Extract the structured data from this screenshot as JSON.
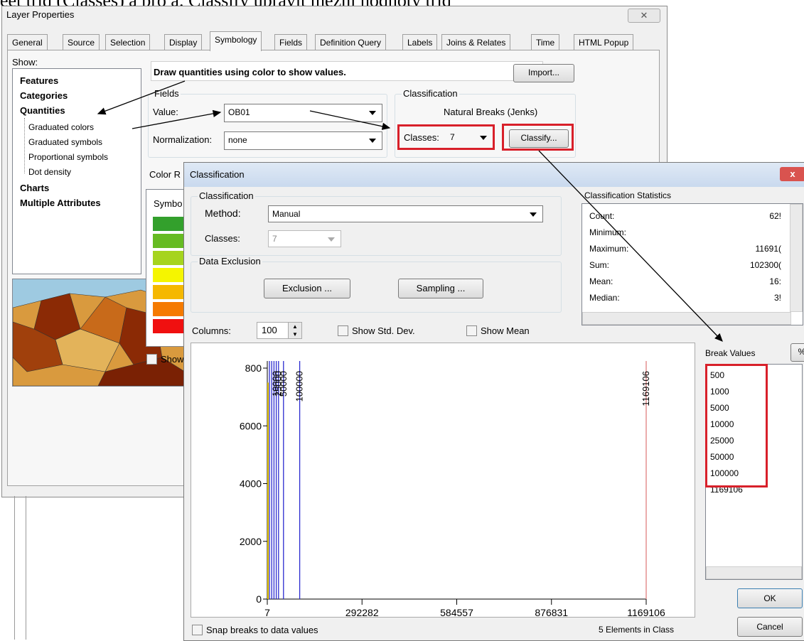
{
  "doc_text": "eet třid (Classes) a pro a. Classify upravit mezní hodnoty tříd",
  "layer_window": {
    "title": "Layer Properties",
    "tabs": [
      "General",
      "Source",
      "Selection",
      "Display",
      "Symbology",
      "Fields",
      "Definition Query",
      "Labels",
      "Joins & Relates",
      "Time",
      "HTML Popup"
    ],
    "show_label": "Show:",
    "tree": [
      "Features",
      "Categories",
      "Quantities",
      "Graduated colors",
      "Graduated symbols",
      "Proportional symbols",
      "Dot density",
      "Charts",
      "Multiple Attributes"
    ],
    "description": "Draw quantities using color to show values.",
    "import_label": "Import...",
    "fields_group": "Fields",
    "value_label": "Value:",
    "value": "OB01",
    "normalization_label": "Normalization:",
    "normalization": "none",
    "classification_group": "Classification",
    "classification_method": "Natural Breaks (Jenks)",
    "classes_label": "Classes:",
    "classes_value": "7",
    "classify_label": "Classify...",
    "color_ramp_label": "Color R",
    "symbol_label": "Symbo",
    "show_cut": "Show",
    "swatch_colors": [
      "#33a02c",
      "#66bb22",
      "#a6d41e",
      "#f5f500",
      "#f5b800",
      "#f57a00",
      "#f01010"
    ]
  },
  "classification_dialog": {
    "title": "Classification",
    "group_label": "Classification",
    "method_label": "Method:",
    "method": "Manual",
    "classes_label": "Classes:",
    "classes_value": "7",
    "exclusion_group": "Data Exclusion",
    "exclusion_button": "Exclusion ...",
    "sampling_button": "Sampling ...",
    "stats_group": "Classification Statistics",
    "stats": [
      {
        "label": "Count:",
        "value": "62!"
      },
      {
        "label": "Minimum:",
        "value": ""
      },
      {
        "label": "Maximum:",
        "value": "11691("
      },
      {
        "label": "Sum:",
        "value": "102300("
      },
      {
        "label": "Mean:",
        "value": "16:"
      },
      {
        "label": "Median:",
        "value": "3!"
      }
    ],
    "columns_label": "Columns:",
    "columns_value": "100",
    "show_std_dev": "Show Std. Dev.",
    "show_mean": "Show Mean",
    "break_values_label": "Break Values",
    "percent_label": "%",
    "break_values": [
      "500",
      "1000",
      "5000",
      "10000",
      "25000",
      "50000",
      "100000",
      "1169106"
    ],
    "snap_label": "Snap breaks to data values",
    "elements_label": "5 Elements in Class",
    "ok_label": "OK",
    "cancel_label": "Cancel"
  },
  "chart_data": {
    "type": "bar",
    "title": "",
    "xlabel": "",
    "ylabel": "",
    "x_ticks": [
      "7",
      "292282",
      "584557",
      "876831",
      "1169106"
    ],
    "y_ticks": [
      "0",
      "2000",
      "4000",
      "6000",
      "800"
    ],
    "ylim": [
      0,
      8000
    ],
    "xlim": [
      7,
      1169106
    ],
    "break_lines": [
      {
        "value": 500,
        "label": ""
      },
      {
        "value": 1000,
        "label": ""
      },
      {
        "value": 5000,
        "label": ""
      },
      {
        "value": 10000,
        "label": "10000"
      },
      {
        "value": 25000,
        "label": "25000"
      },
      {
        "value": 50000,
        "label": "50000"
      },
      {
        "value": 100000,
        "label": "100000"
      },
      {
        "value": 1169106,
        "label": "1169106"
      }
    ],
    "break_color": "#2b2bd0",
    "last_break_color": "#e08080"
  }
}
